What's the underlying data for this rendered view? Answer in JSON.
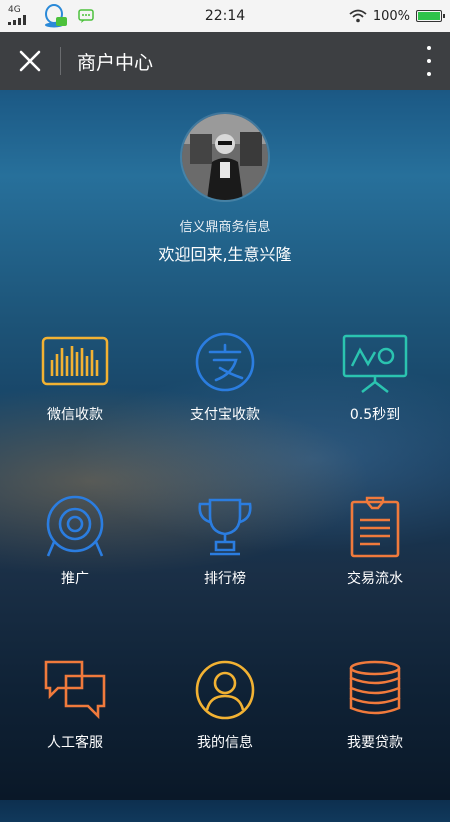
{
  "status": {
    "network": "4G",
    "time": "22:14",
    "battery": "100%",
    "battery_level": 1.0
  },
  "header": {
    "title": "商户中心"
  },
  "profile": {
    "shop_name": "信义鼎商务信息",
    "welcome": "欢迎回来,生意兴隆"
  },
  "menu": [
    {
      "label": "微信收款",
      "icon": "wechat-collect-icon",
      "color": "#f2b233"
    },
    {
      "label": "支付宝收款",
      "icon": "alipay-icon",
      "color": "#2b7de0"
    },
    {
      "label": "0.5秒到",
      "icon": "presentation-board-icon",
      "color": "#2bc4b0"
    },
    {
      "label": "推广",
      "icon": "target-icon",
      "color": "#2b7de0"
    },
    {
      "label": "排行榜",
      "icon": "trophy-icon",
      "color": "#2b7de0"
    },
    {
      "label": "交易流水",
      "icon": "clipboard-icon",
      "color": "#f07a3c"
    },
    {
      "label": "人工客服",
      "icon": "chat-bubbles-icon",
      "color": "#f07a3c"
    },
    {
      "label": "我的信息",
      "icon": "user-profile-icon",
      "color": "#f2b233"
    },
    {
      "label": "我要贷款",
      "icon": "coin-stack-icon",
      "color": "#f07a3c"
    }
  ]
}
